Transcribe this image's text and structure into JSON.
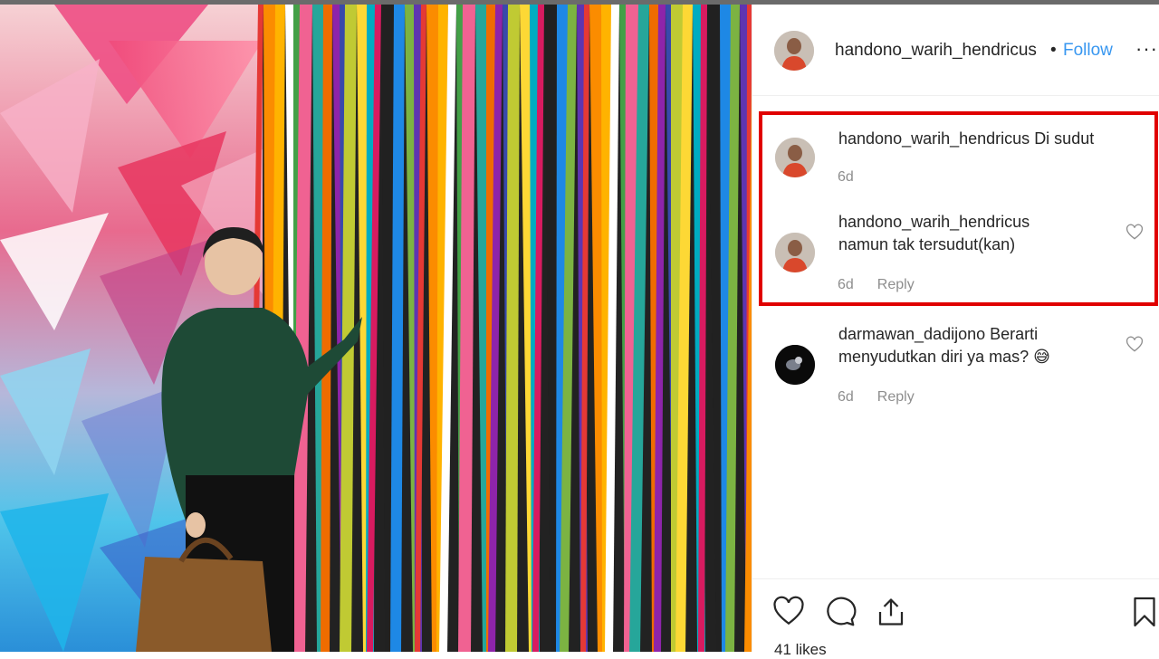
{
  "post": {
    "author": "handono_warih_hendricus",
    "follow_label": "Follow",
    "separator": "•",
    "more_icon": "···"
  },
  "comments": [
    {
      "username": "handono_warih_hendricus",
      "text": "Di sudut",
      "time": "6d",
      "reply": ""
    },
    {
      "username": "handono_warih_hendricus",
      "text": "namun tak tersudut(kan)",
      "time": "6d",
      "reply": "Reply"
    },
    {
      "username": "darmawan_dadijono",
      "text": "Berarti menyudutkan diri ya mas? 😅",
      "time": "6d",
      "reply": "Reply"
    }
  ],
  "footer": {
    "likes": "41 likes"
  },
  "colors": {
    "follow": "#3897f0",
    "highlight": "#e00000",
    "muted": "#8e8e8e"
  }
}
